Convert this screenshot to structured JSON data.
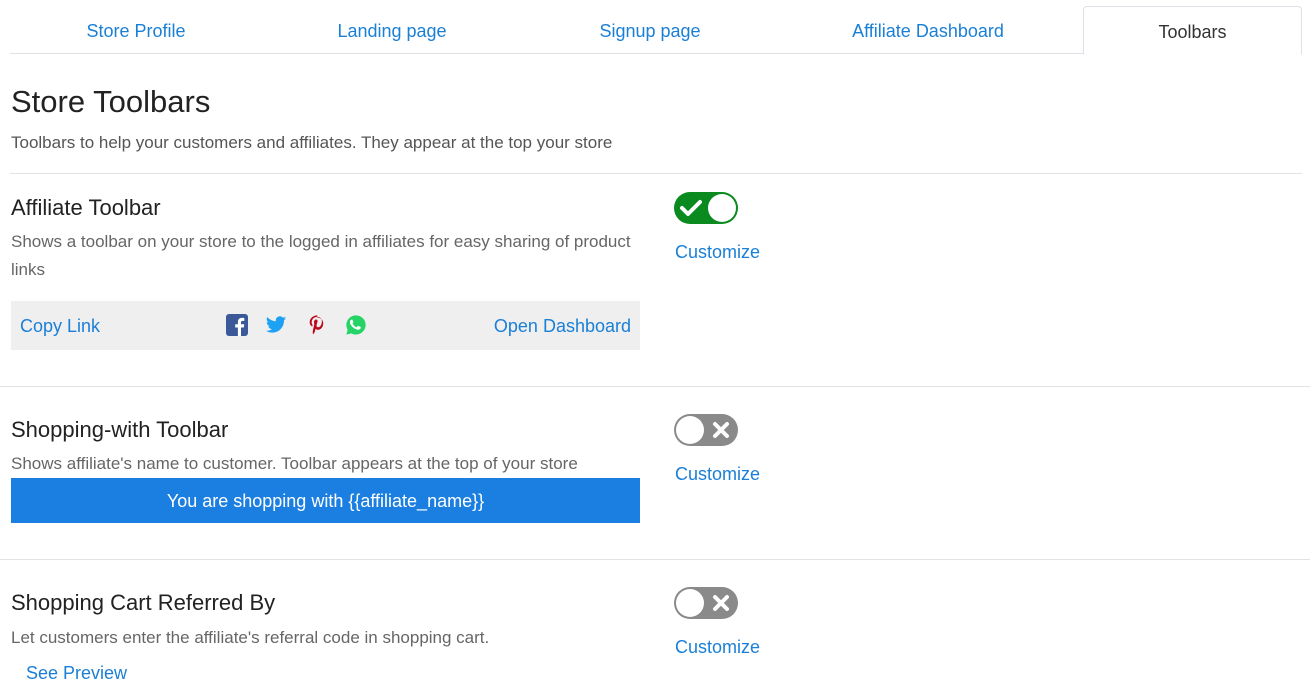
{
  "tabs": [
    {
      "label": "Store Profile"
    },
    {
      "label": "Landing page"
    },
    {
      "label": "Signup page"
    },
    {
      "label": "Affiliate Dashboard"
    },
    {
      "label": "Toolbars",
      "active": true
    }
  ],
  "header": {
    "title": "Store Toolbars",
    "description": "Toolbars to help your customers and affiliates. They appear at the top your store"
  },
  "affiliate_toolbar": {
    "title": "Affiliate Toolbar",
    "description": "Shows a toolbar on your store to the logged in affiliates for easy sharing of product links",
    "enabled": true,
    "customize_label": "Customize",
    "preview": {
      "copy_link_label": "Copy Link",
      "open_dashboard_label": "Open Dashboard",
      "share_icons": [
        "facebook-icon",
        "twitter-icon",
        "pinterest-icon",
        "whatsapp-icon"
      ]
    }
  },
  "shopping_with_toolbar": {
    "title": "Shopping-with Toolbar",
    "description": "Shows affiliate's name to customer. Toolbar appears at the top of your store",
    "enabled": false,
    "customize_label": "Customize",
    "preview_text": "You are shopping with {{affiliate_name}}"
  },
  "shopping_cart_referred_by": {
    "title": "Shopping Cart Referred By",
    "description": "Let customers enter the affiliate's referral code in shopping cart.",
    "enabled": false,
    "customize_label": "Customize",
    "see_preview_label": "See Preview"
  },
  "colors": {
    "link": "#1a7fd6",
    "toggle_on": "#0b8a1f",
    "toggle_off": "#8a8a8a",
    "shop_bar": "#1a7fe0",
    "aff_bar": "#efefef",
    "facebook": "#3b5998",
    "twitter": "#1da1f2",
    "pinterest": "#bd081c",
    "whatsapp": "#25d366"
  }
}
